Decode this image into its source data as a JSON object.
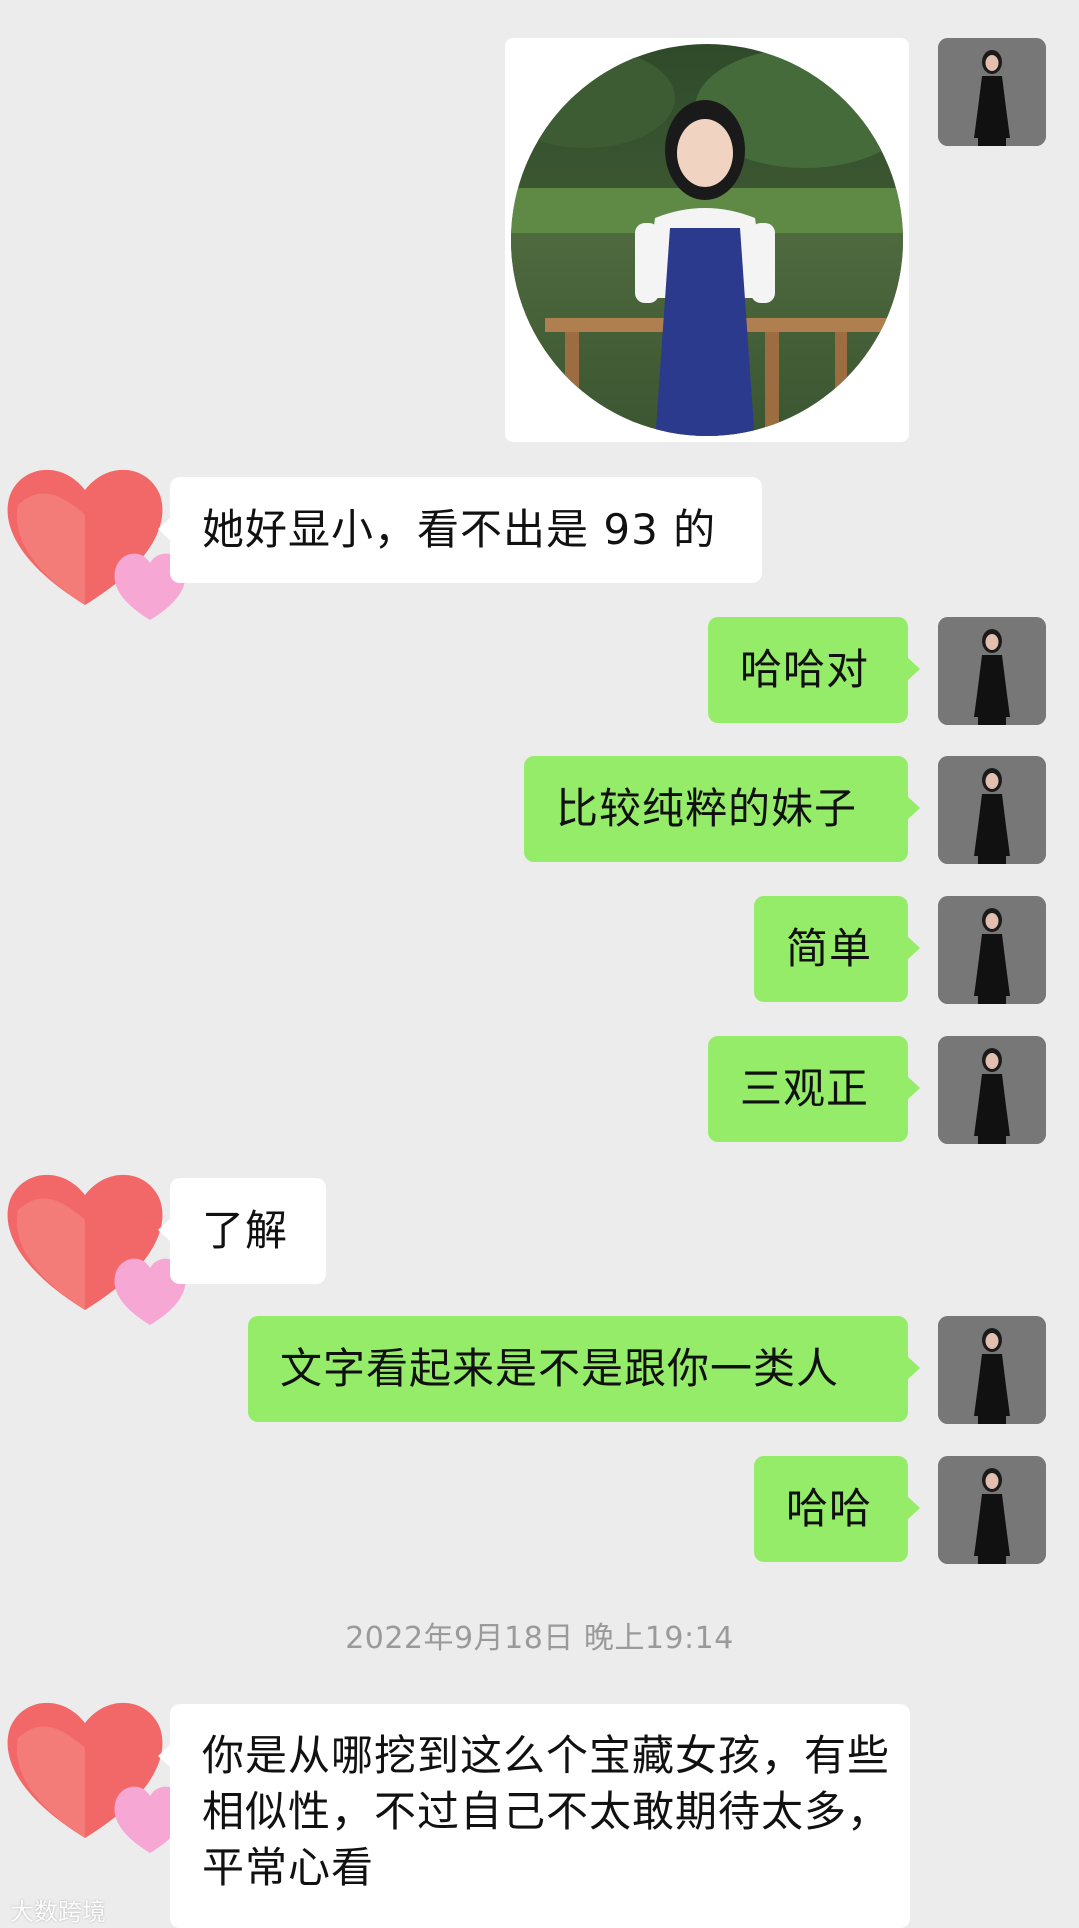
{
  "messages": [
    {
      "text": "她好显小，看不出是 93 的"
    },
    {
      "text": "哈哈对"
    },
    {
      "text": "比较纯粹的妹子"
    },
    {
      "text": "简单"
    },
    {
      "text": "三观正"
    },
    {
      "text": "了解"
    },
    {
      "text": "文字看起来是不是跟你一类人"
    },
    {
      "text": "哈哈"
    },
    {
      "text": "你是从哪挖到这么个宝藏女孩，有些相似性，不过自己不太敢期待太多，平常心看"
    }
  ],
  "timestamp": "2022年9月18日  晚上19:14",
  "watermark": "大数跨境",
  "colors": {
    "background": "#ececec",
    "sent_bubble": "#95ec69",
    "received_bubble": "#ffffff"
  },
  "icons": {
    "contact_avatar": "heart-avatar",
    "self_avatar": "woman-photo-avatar"
  }
}
